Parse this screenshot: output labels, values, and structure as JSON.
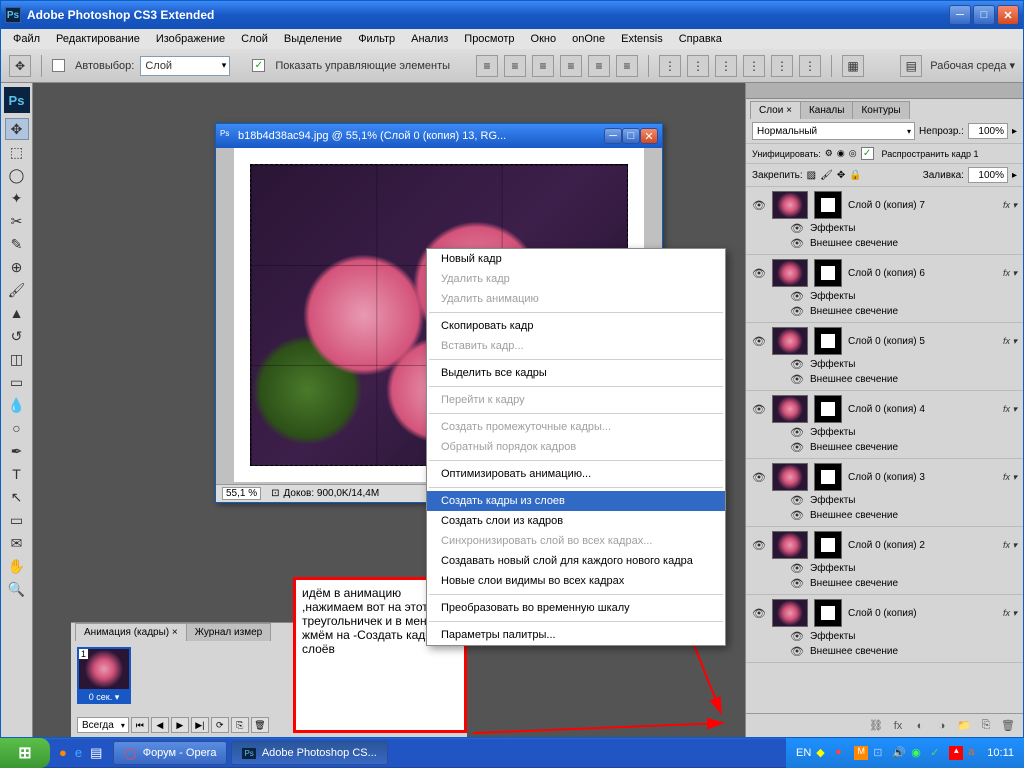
{
  "app": {
    "title": "Adobe Photoshop CS3 Extended",
    "psBadge": "Ps"
  },
  "menu": [
    "Файл",
    "Редактирование",
    "Изображение",
    "Слой",
    "Выделение",
    "Фильтр",
    "Анализ",
    "Просмотр",
    "Окно",
    "onOne",
    "Extensis",
    "Справка"
  ],
  "options": {
    "autopick_cb": "",
    "autopick": "Автовыбор:",
    "layerSelect": "Слой",
    "showControls_cb": "✓",
    "showControls": "Показать управляющие элементы",
    "workspace": "Рабочая среда ▾"
  },
  "doc": {
    "title": "b18b4d38ac94.jpg @ 55,1% (Слой 0 (копия) 13, RG...",
    "zoom": "55,1 %",
    "info": "Доков: 900,0K/14,4M"
  },
  "panel": {
    "tabs": [
      "Слои ×",
      "Каналы",
      "Контуры"
    ],
    "blend": "Нормальный",
    "opacityLabel": "Непрозр.:",
    "opacity": "100%",
    "unifyLabel": "Унифицировать:",
    "propagate_cb": "✓",
    "propagate": "Распространить кадр 1",
    "lockLabel": "Закрепить:",
    "fillLabel": "Заливка:",
    "fill": "100%",
    "fxLabel": "fx ▾",
    "effects": "Эффекты",
    "outerGlow": "Внешнее свечение"
  },
  "layers": [
    {
      "name": "Слой 0 (копия) 7"
    },
    {
      "name": "Слой 0 (копия) 6"
    },
    {
      "name": "Слой 0 (копия) 5"
    },
    {
      "name": "Слой 0 (копия) 4"
    },
    {
      "name": "Слой 0 (копия) 3"
    },
    {
      "name": "Слой 0 (копия) 2"
    },
    {
      "name": "Слой 0 (копия)"
    }
  ],
  "ctxMenu": [
    {
      "t": "Новый кадр",
      "d": false
    },
    {
      "t": "Удалить кадр",
      "d": true
    },
    {
      "t": "Удалить анимацию",
      "d": true
    },
    {
      "sep": true
    },
    {
      "t": "Скопировать кадр",
      "d": false
    },
    {
      "t": "Вставить кадр...",
      "d": true
    },
    {
      "sep": true
    },
    {
      "t": "Выделить все кадры",
      "d": false
    },
    {
      "sep": true
    },
    {
      "t": "Перейти к кадру",
      "d": true
    },
    {
      "sep": true
    },
    {
      "t": "Создать промежуточные кадры...",
      "d": true
    },
    {
      "t": "Обратный порядок кадров",
      "d": true
    },
    {
      "sep": true
    },
    {
      "t": "Оптимизировать анимацию...",
      "d": false
    },
    {
      "sep": true
    },
    {
      "t": "Создать кадры из слоев",
      "d": false,
      "hl": true
    },
    {
      "t": "Создать слои из кадров",
      "d": false
    },
    {
      "t": "Синхронизировать слой во всех кадрах...",
      "d": true
    },
    {
      "t": "Создавать новый слой для каждого нового кадра",
      "d": false
    },
    {
      "t": "Новые слои видимы во всех кадрах",
      "d": false
    },
    {
      "sep": true
    },
    {
      "t": "Преобразовать во временную шкалу",
      "d": false
    },
    {
      "sep": true
    },
    {
      "t": "Параметры палитры...",
      "d": false
    }
  ],
  "instruction": "идём в анимацию ,нажимаем вот на этот треугольничек и в меню жмём на -Создать кадры из слоёв",
  "anim": {
    "tab1": "Анимация (кадры) ×",
    "tab2": "Журнал измер",
    "frameNum": "1",
    "frameTime": "0 сек. ▾",
    "always": "Всегда"
  },
  "taskbar": {
    "lang": "EN",
    "time": "10:11",
    "task1": "Форум - Opera",
    "task2": "Adobe Photoshop CS..."
  }
}
